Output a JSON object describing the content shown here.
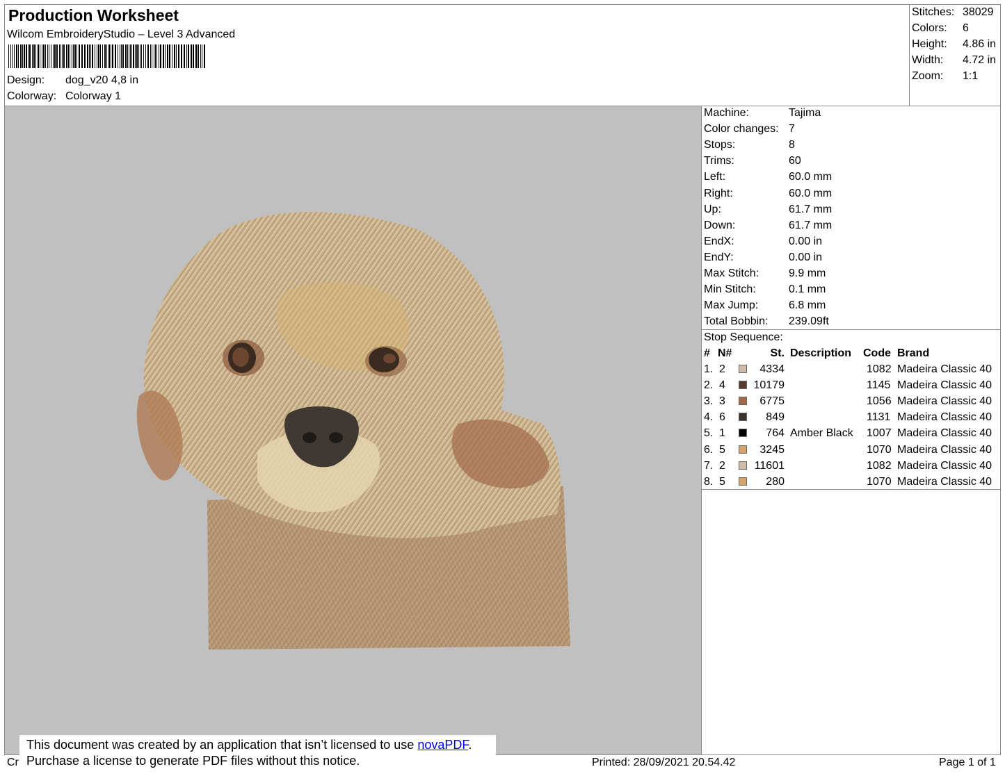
{
  "header": {
    "title": "Production Worksheet",
    "software": "Wilcom EmbroideryStudio – Level 3 Advanced",
    "design_label": "Design:",
    "design_value": "dog_v20 4,8 in",
    "colorway_label": "Colorway:",
    "colorway_value": "Colorway 1"
  },
  "stats": [
    {
      "label": "Stitches:",
      "value": "38029"
    },
    {
      "label": "Colors:",
      "value": "6"
    },
    {
      "label": "Height:",
      "value": "4.86 in"
    },
    {
      "label": "Width:",
      "value": "4.72 in"
    },
    {
      "label": "Zoom:",
      "value": "1:1"
    }
  ],
  "machine_info": [
    {
      "label": "Machine:",
      "value": "Tajima"
    },
    {
      "label": "Color changes:",
      "value": "7"
    },
    {
      "label": "Stops:",
      "value": "8"
    },
    {
      "label": "Trims:",
      "value": "60"
    },
    {
      "label": "Left:",
      "value": "60.0 mm"
    },
    {
      "label": "Right:",
      "value": "60.0 mm"
    },
    {
      "label": "Up:",
      "value": "61.7 mm"
    },
    {
      "label": "Down:",
      "value": "61.7 mm"
    },
    {
      "label": "EndX:",
      "value": "0.00 in"
    },
    {
      "label": "EndY:",
      "value": "0.00 in"
    },
    {
      "label": "Max Stitch:",
      "value": "9.9 mm"
    },
    {
      "label": "Min Stitch:",
      "value": "0.1 mm"
    },
    {
      "label": "Max Jump:",
      "value": "6.8 mm"
    },
    {
      "label": "Total Bobbin:",
      "value": "239.09ft"
    }
  ],
  "stop_sequence": {
    "title": "Stop Sequence:",
    "headers": {
      "num": "#",
      "needle": "N#",
      "stitches": "St.",
      "description": "Description",
      "code": "Code",
      "brand": "Brand"
    },
    "rows": [
      {
        "num": "1.",
        "needle": "2",
        "color": "#d2bba5",
        "stitches": "4334",
        "description": "",
        "code": "1082",
        "brand": "Madeira Classic 40"
      },
      {
        "num": "2.",
        "needle": "4",
        "color": "#5a3a2e",
        "stitches": "10179",
        "description": "",
        "code": "1145",
        "brand": "Madeira Classic 40"
      },
      {
        "num": "3.",
        "needle": "3",
        "color": "#a3694c",
        "stitches": "6775",
        "description": "",
        "code": "1056",
        "brand": "Madeira Classic 40"
      },
      {
        "num": "4.",
        "needle": "6",
        "color": "#3a3431",
        "stitches": "849",
        "description": "",
        "code": "1131",
        "brand": "Madeira Classic 40"
      },
      {
        "num": "5.",
        "needle": "1",
        "color": "#000000",
        "stitches": "764",
        "description": "Amber Black",
        "code": "1007",
        "brand": "Madeira Classic 40"
      },
      {
        "num": "6.",
        "needle": "5",
        "color": "#d4a46c",
        "stitches": "3245",
        "description": "",
        "code": "1070",
        "brand": "Madeira Classic 40"
      },
      {
        "num": "7.",
        "needle": "2",
        "color": "#d2bba5",
        "stitches": "11601",
        "description": "",
        "code": "1082",
        "brand": "Madeira Classic 40"
      },
      {
        "num": "8.",
        "needle": "5",
        "color": "#d4a46c",
        "stitches": "280",
        "description": "",
        "code": "1070",
        "brand": "Madeira Classic 40"
      }
    ]
  },
  "notice": {
    "line1_prefix": "This document was created by an application that isn’t licensed to use ",
    "link": "novaPDF",
    "line1_suffix": ".",
    "line2": "Purchase a license to generate PDF files without this notice."
  },
  "footer": {
    "created_fragment": "Cr",
    "printed": "Printed: 28/09/2021 20.54.42",
    "page": "Page 1 of 1"
  },
  "colors": {
    "preview_background": "#c0c0c0",
    "border": "#8a8a8a",
    "link": "#0000ee"
  }
}
